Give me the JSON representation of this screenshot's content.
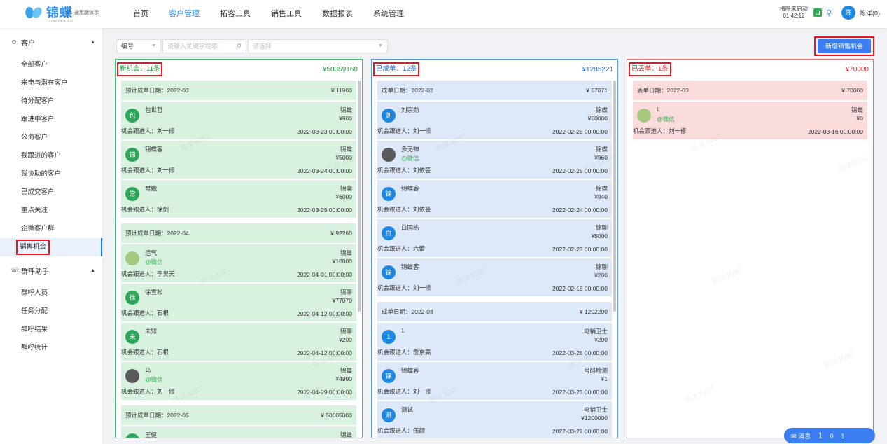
{
  "header": {
    "brand": "锦蝶",
    "brand_en": "JINCHEN.CO",
    "edition": "通用版演示",
    "nav": [
      "首页",
      "客户管理",
      "拓客工具",
      "销售工具",
      "数据报表",
      "系统管理"
    ],
    "active_nav": "客户管理",
    "call_status": "梅呼未启动",
    "call_time": "01:42:12",
    "avatar_char": "陈",
    "user": "陈洋(0)"
  },
  "sidebar": {
    "group1": "客户",
    "items1": [
      "全部客户",
      "来电与潜在客户",
      "待分配客户",
      "跟进中客户",
      "公海客户",
      "我跟进的客户",
      "我协助的客户",
      "已成交客户",
      "重点关注",
      "企微客户群",
      "销售机会"
    ],
    "active": "销售机会",
    "group2": "群呼助手",
    "items2": [
      "群呼人员",
      "任务分配",
      "群呼结果",
      "群呼统计"
    ]
  },
  "toolbar": {
    "select1": "编号",
    "search_placeholder": "请输入关键字搜索",
    "select2_placeholder": "请选择",
    "new_button": "新增销售机会"
  },
  "columns": [
    {
      "title": "新机会：11条",
      "total": "¥50359160",
      "groups": [
        {
          "label": "预计成单日期：2022-03",
          "sum": "¥ 11900",
          "cards": [
            {
              "avatar": "包",
              "name": "包世哲",
              "wechat": "",
              "product": "锦蝶",
              "amount": "¥900",
              "owner": "机会跟进人：刘一修",
              "date": "2022-03-23 00:00:00"
            },
            {
              "avatar": "锦",
              "name": "锦蝶客",
              "wechat": "",
              "product": "锦蝶",
              "amount": "¥5000",
              "owner": "机会跟进人：刘一修",
              "date": "2022-03-24 00:00:00"
            },
            {
              "avatar": "常",
              "name": "常娥",
              "wechat": "",
              "product": "锦聊",
              "amount": "¥6000",
              "owner": "机会跟进人：徐剑",
              "date": "2022-03-25 00:00:00"
            }
          ]
        },
        {
          "label": "预计成单日期：2022-04",
          "sum": "¥ 92260",
          "cards": [
            {
              "avatar": "",
              "name": "运气",
              "wechat": "@微信",
              "product": "锦蝶",
              "amount": "¥10000",
              "owner": "机会跟进人：李昊天",
              "date": "2022-04-01 00:00:00"
            },
            {
              "avatar": "徐",
              "name": "徐雪松",
              "wechat": "",
              "product": "锦聊",
              "amount": "¥77070",
              "owner": "机会跟进人：石根",
              "date": "2022-04-12 00:00:00"
            },
            {
              "avatar": "未",
              "name": "未知",
              "wechat": "",
              "product": "锦聊",
              "amount": "¥200",
              "owner": "机会跟进人：石根",
              "date": "2022-04-12 00:00:00"
            },
            {
              "avatar": "",
              "name": "马",
              "wechat": "@微信",
              "product": "锦蝶",
              "amount": "¥4990",
              "owner": "机会跟进人：刘一修",
              "date": "2022-04-29 00:00:00"
            }
          ]
        },
        {
          "label": "预计成单日期：2022-05",
          "sum": "¥ 50005000",
          "cards": [
            {
              "avatar": "王",
              "name": "王健",
              "wechat": "",
              "product": "锦蝶",
              "amount": "",
              "owner": "",
              "date": ""
            }
          ]
        }
      ]
    },
    {
      "title": "已成单：12条",
      "total": "¥1285221",
      "groups": [
        {
          "label": "成单日期：2022-02",
          "sum": "¥ 57071",
          "cards": [
            {
              "avatar": "刘",
              "name": "刘宗勋",
              "wechat": "",
              "product": "锦蝶",
              "amount": "¥50000",
              "owner": "机会跟进人：刘一修",
              "date": "2022-02-28 00:00:00"
            },
            {
              "avatar": "",
              "name": "多无神",
              "wechat": "@微信",
              "product": "锦蝶",
              "amount": "¥960",
              "owner": "机会跟进人：刘依芸",
              "date": "2022-02-25 00:00:00"
            },
            {
              "avatar": "锦",
              "name": "锦蝶客",
              "wechat": "",
              "product": "锦蝶",
              "amount": "¥940",
              "owner": "机会跟进人：刘依芸",
              "date": "2022-02-24 00:00:00"
            },
            {
              "avatar": "白",
              "name": "白国栋",
              "wechat": "",
              "product": "锦聊",
              "amount": "¥5000",
              "owner": "机会跟进人：六蕾",
              "date": "2022-02-23 00:00:00"
            },
            {
              "avatar": "锦",
              "name": "锦蝶客",
              "wechat": "",
              "product": "锦聊",
              "amount": "¥200",
              "owner": "机会跟进人：刘一修",
              "date": "2022-02-18 00:00:00"
            }
          ]
        },
        {
          "label": "成单日期：2022-03",
          "sum": "¥ 1202200",
          "cards": [
            {
              "avatar": "1",
              "name": "1",
              "wechat": "",
              "product": "电销卫士",
              "amount": "¥200",
              "owner": "机会跟进人：詹京高",
              "date": "2022-03-28 00:00:00"
            },
            {
              "avatar": "锦",
              "name": "锦蝶客",
              "wechat": "",
              "product": "号码检测",
              "amount": "¥1",
              "owner": "机会跟进人：刘一修",
              "date": "2022-03-23 00:00:00"
            },
            {
              "avatar": "测",
              "name": "测试",
              "wechat": "",
              "product": "电销卫士",
              "amount": "¥1200000",
              "owner": "机会跟进人：伍颜",
              "date": "2022-03-22 00:00:00"
            }
          ]
        }
      ]
    },
    {
      "title": "已丢单：1条",
      "total": "¥70000",
      "groups": [
        {
          "label": "丢单日期：2022-03",
          "sum": "¥ 70000",
          "cards": [
            {
              "avatar": "",
              "name": "L",
              "wechat": "@微信",
              "product": "锦蝶",
              "amount": "¥0",
              "owner": "机会跟进人：刘一修",
              "date": "2022-03-16 00:00:00"
            }
          ]
        }
      ]
    }
  ],
  "watermark": "陈洋 8287",
  "message_bar": {
    "label": "消息",
    "a": "1",
    "b": "0",
    "c": "1"
  },
  "colors": {
    "accent": "#1e88e5",
    "green": "#1d9a3c",
    "blue": "#1e6fd9",
    "red": "#e0262e",
    "highlight": "#e8161f"
  }
}
